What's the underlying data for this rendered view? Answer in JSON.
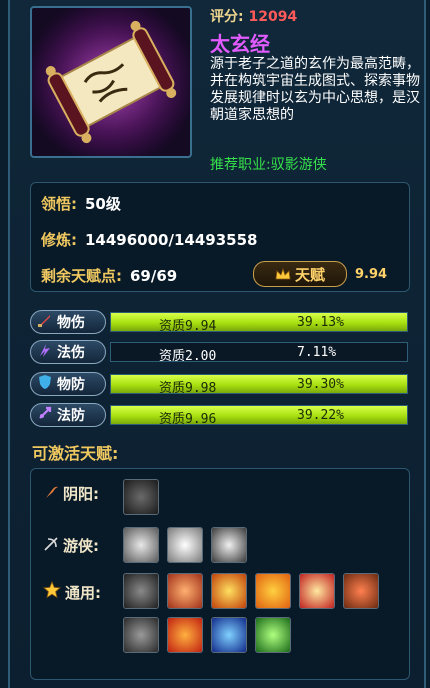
{
  "header": {
    "score_label": "评分:",
    "score_value": "12094",
    "item_name": "太玄经",
    "description": "源于老子之道的玄作为最高范畴，并在构筑宇宙生成图式、探索事物发展规律时以玄为中心思想，是汉朝道家思想的",
    "recommend": "推荐职业:驭影游侠"
  },
  "stats": {
    "comprehension_label": "领悟:",
    "comprehension_value": "50级",
    "cultivation_label": "修炼:",
    "cultivation_value": "14496000/14493558",
    "talent_points_label": "剩余天赋点:",
    "talent_points_value": "69/69",
    "talent_button_label": "天赋",
    "talent_score": "9.94"
  },
  "attributes": [
    {
      "label": "物伤",
      "aptitude": "资质9.94",
      "percent": "39.13%",
      "fill": 1.0,
      "icon": "sword-icon",
      "icon_color": "#e04848"
    },
    {
      "label": "法伤",
      "aptitude": "资质2.00",
      "percent": "7.11%",
      "fill": 0.0,
      "icon": "magic-icon",
      "icon_color": "#b070ff"
    },
    {
      "label": "物防",
      "aptitude": "资质9.98",
      "percent": "39.30%",
      "fill": 1.0,
      "icon": "shield-icon",
      "icon_color": "#40b0e8"
    },
    {
      "label": "法防",
      "aptitude": "资质9.96",
      "percent": "39.22%",
      "fill": 1.0,
      "icon": "magic-shield-icon",
      "icon_color": "#c080ff"
    }
  ],
  "talents": {
    "section_title": "可激活天赋:",
    "categories": [
      {
        "label": "阴阳:",
        "icon": "sickle-icon"
      },
      {
        "label": "游侠:",
        "icon": "bow-icon"
      },
      {
        "label": "通用:",
        "icon": "star-icon"
      }
    ]
  },
  "colors": {
    "accent_gold": "#f0c860",
    "item_name": "#e15bff",
    "score": "#ff5a5a",
    "recommend": "#35e04a",
    "bar_fill": "#a8e010"
  }
}
